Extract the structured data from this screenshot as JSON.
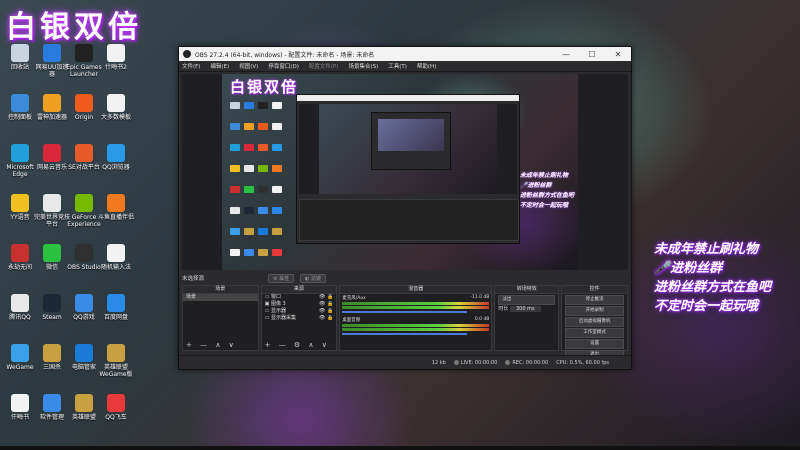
{
  "wallpaper_title": "白银双倍",
  "overlay_lines": [
    "未成年禁止刷礼物",
    "🎤进粉丝群",
    "进粉丝群方式在鱼吧",
    "不定时会一起玩哦"
  ],
  "desktop_icons": [
    {
      "label": "回收站",
      "color": "#c8d4e0"
    },
    {
      "label": "网易UU加速器",
      "color": "#2a7be0"
    },
    {
      "label": "Epic Games Launcher",
      "color": "#222222"
    },
    {
      "label": "什晦书2",
      "color": "#f2f2f2"
    },
    {
      "label": "控制面板",
      "color": "#3a8ad8"
    },
    {
      "label": "雷神加速器",
      "color": "#f0a020"
    },
    {
      "label": "Origin",
      "color": "#f05a1a"
    },
    {
      "label": "大多数模板",
      "color": "#f2f2f2"
    },
    {
      "label": "Microsoft Edge",
      "color": "#1fa0d8"
    },
    {
      "label": "网易云音乐",
      "color": "#d8283a"
    },
    {
      "label": "SE对战平台",
      "color": "#e85a2a"
    },
    {
      "label": "QQ浏览器",
      "color": "#2a9ae8"
    },
    {
      "label": "YY语音",
      "color": "#f0c020"
    },
    {
      "label": "完美世界竞技平台",
      "color": "#e8e8e8"
    },
    {
      "label": "GeForce Experience",
      "color": "#76b900"
    },
    {
      "label": "斗鱼直播伴侣",
      "color": "#f07a20"
    },
    {
      "label": "永劫无间",
      "color": "#c83030"
    },
    {
      "label": "微信",
      "color": "#2ac040"
    },
    {
      "label": "OBS Studio",
      "color": "#303030"
    },
    {
      "label": "随机输入法",
      "color": "#f2f2f2"
    },
    {
      "label": "腾讯QQ",
      "color": "#e8e8e8"
    },
    {
      "label": "Steam",
      "color": "#1b2838"
    },
    {
      "label": "QQ游戏",
      "color": "#3a8ae8"
    },
    {
      "label": "百度网盘",
      "color": "#2a8ae8"
    },
    {
      "label": "WeGame",
      "color": "#3aa0e8"
    },
    {
      "label": "三国杀",
      "color": "#c8a040"
    },
    {
      "label": "电脑管家",
      "color": "#1a7ad8"
    },
    {
      "label": "英雄联盟WeGame版",
      "color": "#c8a040"
    },
    {
      "label": "仟晦书",
      "color": "#f2f2f2"
    },
    {
      "label": "软件管理",
      "color": "#3a8ae8"
    },
    {
      "label": "英雄联盟",
      "color": "#c8a040"
    },
    {
      "label": "QQ飞车",
      "color": "#e83a3a"
    }
  ],
  "obs": {
    "window_title": "OBS 27.2.4 (64-bit, windows) - 配置文件: 未命名 - 场景: 未命名",
    "window_controls": [
      "—",
      "☐",
      "✕"
    ],
    "menu": [
      "文件(F)",
      "编辑(E)",
      "视图(V)",
      "停靠窗口(D)",
      "配置文件(P)",
      "场景集合(S)",
      "工具(T)",
      "帮助(H)"
    ],
    "source_bar": {
      "label": "未选择源",
      "properties": "⚙ 属性",
      "filters": "◐ 滤镜"
    },
    "docks": {
      "scenes": {
        "title": "场景",
        "items": [
          "场景"
        ],
        "footer": "+ — ∧ ∨"
      },
      "sources": {
        "title": "来源",
        "items": [
          "窗口",
          "图像 3",
          "显示器",
          "显示器采集"
        ],
        "footer": "+ — ⚙ ∧ ∨"
      },
      "mixer": {
        "title": "混音器",
        "tracks": [
          {
            "name": "麦克风/Aux",
            "db": "-11.0 dB"
          },
          {
            "name": "桌面音频",
            "db": "0.0 dB"
          }
        ]
      },
      "transitions": {
        "title": "转场特效",
        "type": "淡出",
        "duration_label": "时长",
        "duration": "300 ms"
      },
      "controls": {
        "title": "控件",
        "buttons": [
          "停止推流",
          "开始录制",
          "启动虚拟摄像机",
          "工作室模式",
          "设置",
          "退出"
        ]
      }
    },
    "status": {
      "live": "LIVE: 00:00:00",
      "rec": "REC: 00:00:00",
      "cpu": "CPU: 0.5%, 60.00 fps",
      "bitrate": "12 kb"
    }
  }
}
